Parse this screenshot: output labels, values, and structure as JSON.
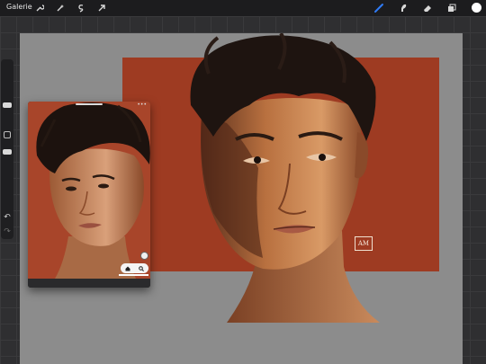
{
  "toolbar": {
    "gallery_label": "Galerie",
    "left_icons": [
      "wrench-icon",
      "magic-wand-icon",
      "selection-icon",
      "transform-arrow-icon"
    ],
    "right_icons": [
      "brush-icon",
      "smudge-icon",
      "eraser-icon",
      "layers-icon"
    ],
    "active_tool": "brush",
    "active_tool_color": "#2f7bf6",
    "current_color": "#ffffff"
  },
  "canvas": {
    "background_color": "#8c8c8c",
    "rectangle_color": "#9e3b22",
    "signature": "AM"
  },
  "reference": {
    "zoom_icon": "zoom-icon",
    "controls": [
      "home-icon",
      "search-icon"
    ]
  }
}
